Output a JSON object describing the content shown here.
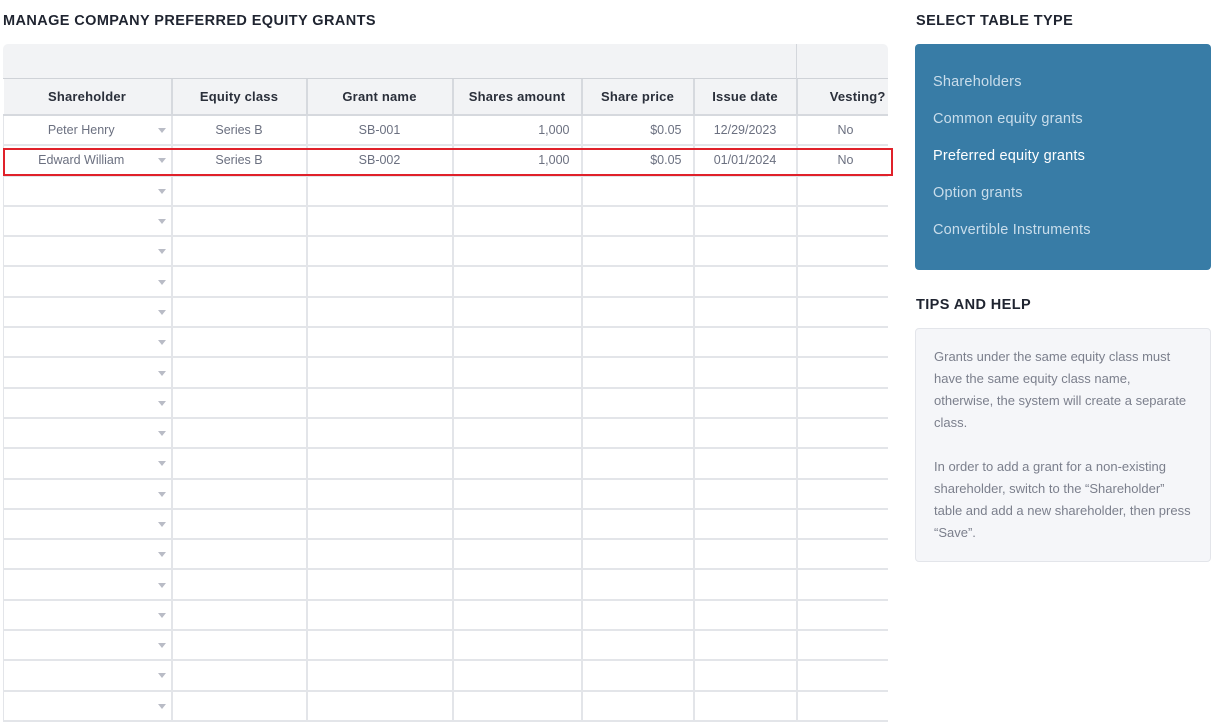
{
  "page": {
    "title": "MANAGE COMPANY PREFERRED EQUITY GRANTS"
  },
  "grid": {
    "columns": [
      {
        "key": "shareholder",
        "label": "Shareholder"
      },
      {
        "key": "equity_class",
        "label": "Equity class"
      },
      {
        "key": "grant_name",
        "label": "Grant name"
      },
      {
        "key": "shares_amount",
        "label": "Shares amount"
      },
      {
        "key": "share_price",
        "label": "Share price"
      },
      {
        "key": "issue_date",
        "label": "Issue date"
      },
      {
        "key": "vesting",
        "label": "Vesting?"
      }
    ],
    "rows": [
      {
        "shareholder": "Peter Henry",
        "equity_class": "Series B",
        "grant_name": "SB-001",
        "shares_amount": "1,000",
        "share_price": "$0.05",
        "issue_date": "12/29/2023",
        "vesting": "No"
      },
      {
        "shareholder": "Edward William",
        "equity_class": "Series B",
        "grant_name": "SB-002",
        "shares_amount": "1,000",
        "share_price": "$0.05",
        "issue_date": "01/01/2024",
        "vesting": "No"
      }
    ],
    "empty_row_count": 18,
    "highlighted_row_index": 1,
    "shareholder_cell_icon": "dropdown-arrow-icon"
  },
  "sidebar": {
    "select_title": "SELECT TABLE TYPE",
    "table_types": [
      {
        "label": "Shareholders",
        "active": false
      },
      {
        "label": "Common equity grants",
        "active": false
      },
      {
        "label": "Preferred equity grants",
        "active": true
      },
      {
        "label": "Option grants",
        "active": false
      },
      {
        "label": "Convertible Instruments",
        "active": false
      }
    ],
    "tips_title": "TIPS AND HELP",
    "tips": [
      "Grants under the same equity class must have the same equity class name, otherwise, the system will create a separate class.",
      "In order to add a grant for a non-existing shareholder, switch to the “Shareholder” table and add a new shareholder, then press “Save”."
    ]
  },
  "colors": {
    "panel_blue": "#387ca6",
    "highlight_red": "#e0212a",
    "header_gray": "#f2f3f5",
    "tips_bg": "#f5f6f9"
  }
}
